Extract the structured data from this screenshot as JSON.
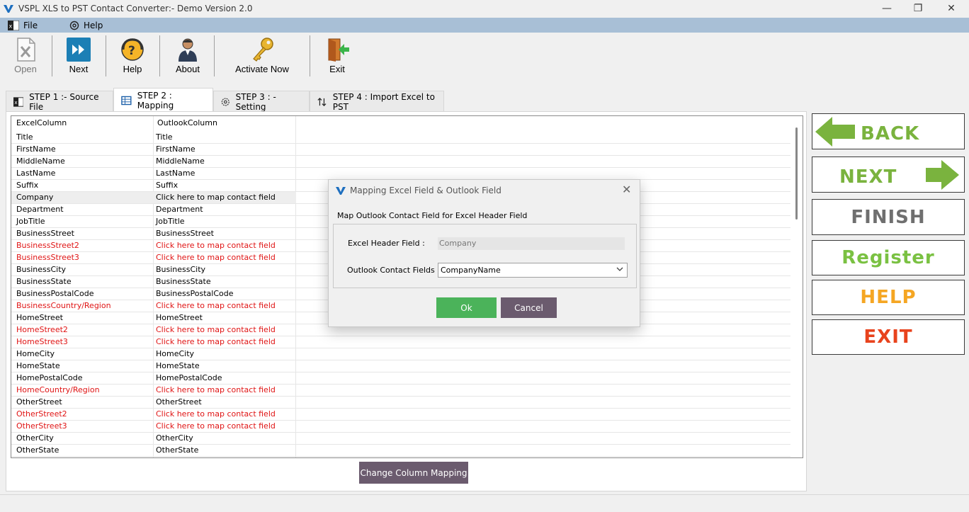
{
  "window": {
    "title": "VSPL XLS to PST Contact Converter:- Demo Version 2.0",
    "minimize_glyph": "—",
    "restore_glyph": "❐",
    "close_glyph": "✕"
  },
  "menu": {
    "file": "File",
    "help": "Help"
  },
  "toolbar": {
    "open": "Open",
    "next": "Next",
    "help": "Help",
    "about": "About",
    "activate": "Activate Now",
    "exit": "Exit"
  },
  "tabs": [
    {
      "label": "STEP 1 :- Source File",
      "icon": "excel-icon"
    },
    {
      "label": "STEP 2 : Mapping",
      "icon": "mapping-icon"
    },
    {
      "label": "STEP 3 : - Setting",
      "icon": "gear-icon"
    },
    {
      "label": "STEP 4 : Import Excel to PST",
      "icon": "sort-arrows-icon"
    }
  ],
  "grid": {
    "headers": [
      "ExcelColumn",
      "OutlookColumn"
    ],
    "rows": [
      {
        "excel": "Title",
        "outlook": "Title",
        "state": "normal"
      },
      {
        "excel": "FirstName",
        "outlook": "FirstName",
        "state": "normal"
      },
      {
        "excel": "MiddleName",
        "outlook": "MiddleName",
        "state": "normal"
      },
      {
        "excel": "LastName",
        "outlook": "LastName",
        "state": "normal"
      },
      {
        "excel": "Suffix",
        "outlook": "Suffix",
        "state": "normal"
      },
      {
        "excel": "Company",
        "outlook": "Click here to map contact field",
        "state": "selected"
      },
      {
        "excel": "Department",
        "outlook": "Department",
        "state": "normal"
      },
      {
        "excel": "JobTitle",
        "outlook": "JobTitle",
        "state": "normal"
      },
      {
        "excel": "BusinessStreet",
        "outlook": "BusinessStreet",
        "state": "normal"
      },
      {
        "excel": "BusinessStreet2",
        "outlook": "Click here to map contact field",
        "state": "unmapped"
      },
      {
        "excel": "BusinessStreet3",
        "outlook": "Click here to map contact field",
        "state": "unmapped"
      },
      {
        "excel": "BusinessCity",
        "outlook": "BusinessCity",
        "state": "normal"
      },
      {
        "excel": "BusinessState",
        "outlook": "BusinessState",
        "state": "normal"
      },
      {
        "excel": "BusinessPostalCode",
        "outlook": "BusinessPostalCode",
        "state": "normal"
      },
      {
        "excel": "BusinessCountry/Region",
        "outlook": "Click here to map contact field",
        "state": "unmapped"
      },
      {
        "excel": "HomeStreet",
        "outlook": "HomeStreet",
        "state": "normal"
      },
      {
        "excel": "HomeStreet2",
        "outlook": "Click here to map contact field",
        "state": "unmapped"
      },
      {
        "excel": "HomeStreet3",
        "outlook": "Click here to map contact field",
        "state": "unmapped"
      },
      {
        "excel": "HomeCity",
        "outlook": "HomeCity",
        "state": "normal"
      },
      {
        "excel": "HomeState",
        "outlook": "HomeState",
        "state": "normal"
      },
      {
        "excel": "HomePostalCode",
        "outlook": "HomePostalCode",
        "state": "normal"
      },
      {
        "excel": "HomeCountry/Region",
        "outlook": "Click here to map contact field",
        "state": "unmapped"
      },
      {
        "excel": "OtherStreet",
        "outlook": "OtherStreet",
        "state": "normal"
      },
      {
        "excel": "OtherStreet2",
        "outlook": "Click here to map contact field",
        "state": "unmapped"
      },
      {
        "excel": "OtherStreet3",
        "outlook": "Click here to map contact field",
        "state": "unmapped"
      },
      {
        "excel": "OtherCity",
        "outlook": "OtherCity",
        "state": "normal"
      },
      {
        "excel": "OtherState",
        "outlook": "OtherState",
        "state": "normal"
      }
    ]
  },
  "change_mapping_button": "Change Column Mapping",
  "side_buttons": {
    "back": "BACK",
    "next": "NEXT",
    "finish": "FINISH",
    "register": "Register",
    "help": "HELP",
    "exit": "EXIT"
  },
  "dialog": {
    "title": "Mapping Excel Field & Outlook Field",
    "close_glyph": "✕",
    "subtitle": "Map Outlook Contact Field for Excel Header Field",
    "excel_label": "Excel Header Field :",
    "excel_value": "Company",
    "outlook_label": "Outlook Contact Fields",
    "outlook_value": "CompanyName",
    "ok": "Ok",
    "cancel": "Cancel"
  },
  "colors": {
    "menubar": "#a8bfd6",
    "unmapped_text": "#e01414",
    "back_next_green": "#7ab33e",
    "finish_gray": "#6f6f6f",
    "register_green": "#7ac142",
    "help_orange": "#f5a623",
    "exit_red": "#e8431d",
    "ok_green": "#4bb35a",
    "cancel_plum": "#6b5b6e"
  }
}
